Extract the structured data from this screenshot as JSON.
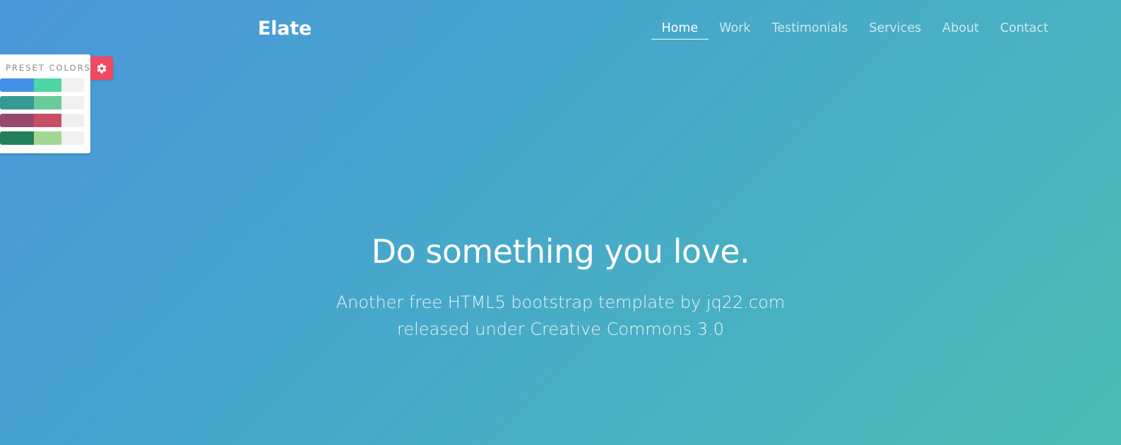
{
  "header": {
    "brand": "Elate",
    "nav": [
      {
        "label": "Home",
        "active": true
      },
      {
        "label": "Work",
        "active": false
      },
      {
        "label": "Testimonials",
        "active": false
      },
      {
        "label": "Services",
        "active": false
      },
      {
        "label": "About",
        "active": false
      },
      {
        "label": "Contact",
        "active": false
      }
    ]
  },
  "hero": {
    "title": "Do something you love.",
    "subtitle": "Another free HTML5 bootstrap template by jq22.com released under Creative Commons 3.0"
  },
  "preset_panel": {
    "title": "PRESET COLORS",
    "toggle_icon": "gear-icon",
    "toggle_color": "#f2485f",
    "rows": [
      {
        "primary": "#4191e8",
        "secondary": "#4fd6a5",
        "tertiary": "#f0f0f0"
      },
      {
        "primary": "#359a96",
        "secondary": "#6bca99",
        "tertiary": "#f0f0f0"
      },
      {
        "primary": "#97486e",
        "secondary": "#c64f65",
        "tertiary": "#f0f0f0"
      },
      {
        "primary": "#22815b",
        "secondary": "#a3d894",
        "tertiary": "#f0f0f0"
      }
    ]
  },
  "background": {
    "gradient_start": "#4a97d9",
    "gradient_mid": "#46a9c9",
    "gradient_end": "#4dbdb5"
  }
}
